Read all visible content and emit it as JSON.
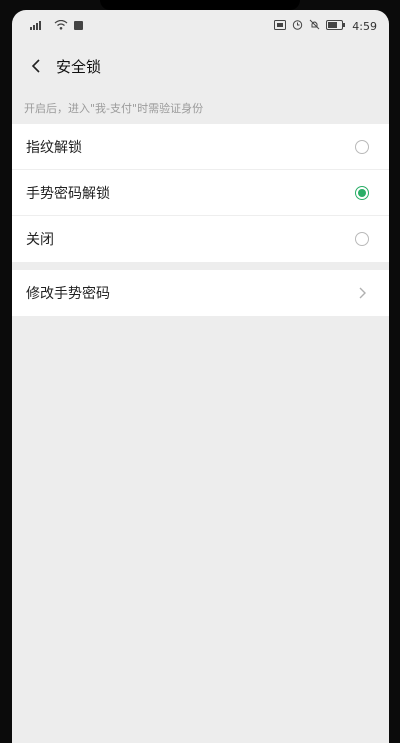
{
  "status_bar": {
    "left_icons": [
      "cell-signal-icon",
      "wifi-icon",
      "notification-icon"
    ],
    "right_icons": [
      "nfc-icon",
      "alarm-icon",
      "mute-icon",
      "battery-icon"
    ],
    "time": "4:59"
  },
  "nav": {
    "title": "安全锁"
  },
  "hint": "开启后，进入\"我-支付\"时需验证身份",
  "options": [
    {
      "label": "指纹解锁",
      "selected": false
    },
    {
      "label": "手势密码解锁",
      "selected": true
    },
    {
      "label": "关闭",
      "selected": false
    }
  ],
  "change_gesture": {
    "label": "修改手势密码"
  },
  "colors": {
    "accent": "#2aae67",
    "background": "#ededed"
  }
}
